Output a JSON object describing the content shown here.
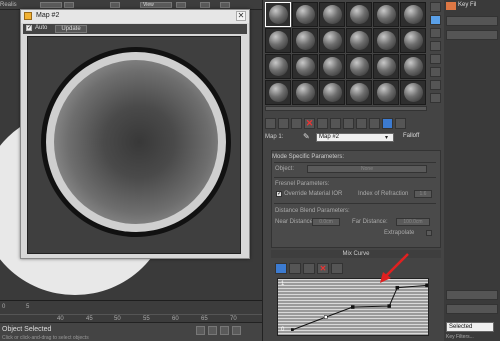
{
  "viewport": {
    "top_label": "Realis",
    "view_menu": "View"
  },
  "timeline": {
    "ticks": [
      "40",
      "45",
      "50",
      "55",
      "60",
      "65",
      "70"
    ],
    "frame_start": "0",
    "frame_5": "5"
  },
  "status": {
    "text": "Object Selected",
    "sub": "Click or click-and-drag to select objects"
  },
  "map_window": {
    "title": "Map #2",
    "auto_label": "Auto",
    "auto_checked": "✓",
    "update_label": "Update",
    "close_glyph": "✕"
  },
  "material_editor": {
    "name_label": "Map 1:",
    "map_name": "Map #2",
    "type_button": "Falloff",
    "mode_params": "Mode Specific Parameters:",
    "object_label": "Object:",
    "object_value": "None",
    "fresnel_label": "Fresnel Parameters:",
    "override_label": "Override Material IOR",
    "ior_label": "Index of Refraction",
    "ior_value": "1.6",
    "distance_label": "Distance Blend Parameters:",
    "near_label": "Near Distance:",
    "near_value": "0.0cm",
    "far_label": "Far Distance:",
    "far_value": "100.0cm",
    "extrapolate_label": "Extrapolate",
    "mix_curve_title": "Mix Curve",
    "graph_y_top": "1",
    "graph_y_bottom": "0"
  },
  "curve": {
    "points": [
      [
        0.0,
        0.0
      ],
      [
        0.25,
        0.28
      ],
      [
        0.45,
        0.5
      ],
      [
        0.72,
        0.52
      ],
      [
        0.78,
        0.92
      ],
      [
        1.0,
        0.97
      ]
    ]
  },
  "right_strip": {
    "label": "Key Fil",
    "selected": "Selected",
    "key_filters": "Key Filters..."
  },
  "accent": {
    "blue": "#3c7bd1",
    "red": "#e33333",
    "arrow_red": "#e02020"
  }
}
